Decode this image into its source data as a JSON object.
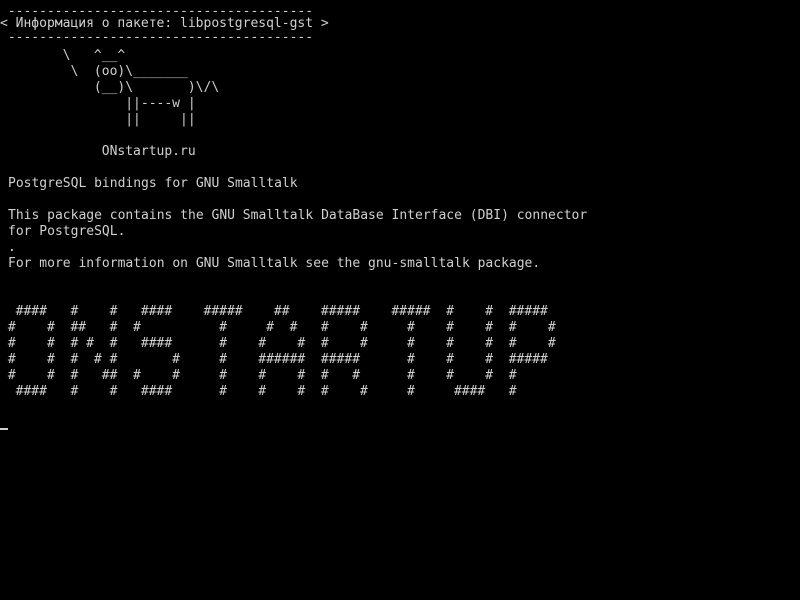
{
  "cowsay": {
    "border_top": " ---------------------------------------",
    "title": "< Информация о пакете: libpostgresql-gst >",
    "border_bottom": " ---------------------------------------",
    "cow": [
      "        \\   ^__^",
      "         \\  (oo)\\_______",
      "            (__)\\       )\\/\\",
      "                ||----w |",
      "                ||     ||"
    ],
    "site": "             ONstartup.ru"
  },
  "description": {
    "summary": "PostgreSQL bindings for GNU Smalltalk",
    "body_line1": "This package contains the GNU Smalltalk DataBase Interface (DBI) connector",
    "body_line2": "for PostgreSQL.",
    "separator": ".",
    "more_info": "For more information on GNU Smalltalk see the gnu-smalltalk package."
  },
  "banner": [
    "  ####   #    #   ####    #####    ##    #####    #####  #    #  #####",
    " #    #  ##   #  #          #     #  #   #    #     #    #    #  #    #",
    " #    #  # #  #   ####      #    #    #  #    #     #    #    #  #    #",
    " #    #  #  # #       #     #    ######  #####      #    #    #  #####",
    " #    #  #   ##  #    #     #    #    #  #   #      #    #    #  #",
    "  ####   #    #   ####      #    #    #  #    #     #     ####   #"
  ]
}
